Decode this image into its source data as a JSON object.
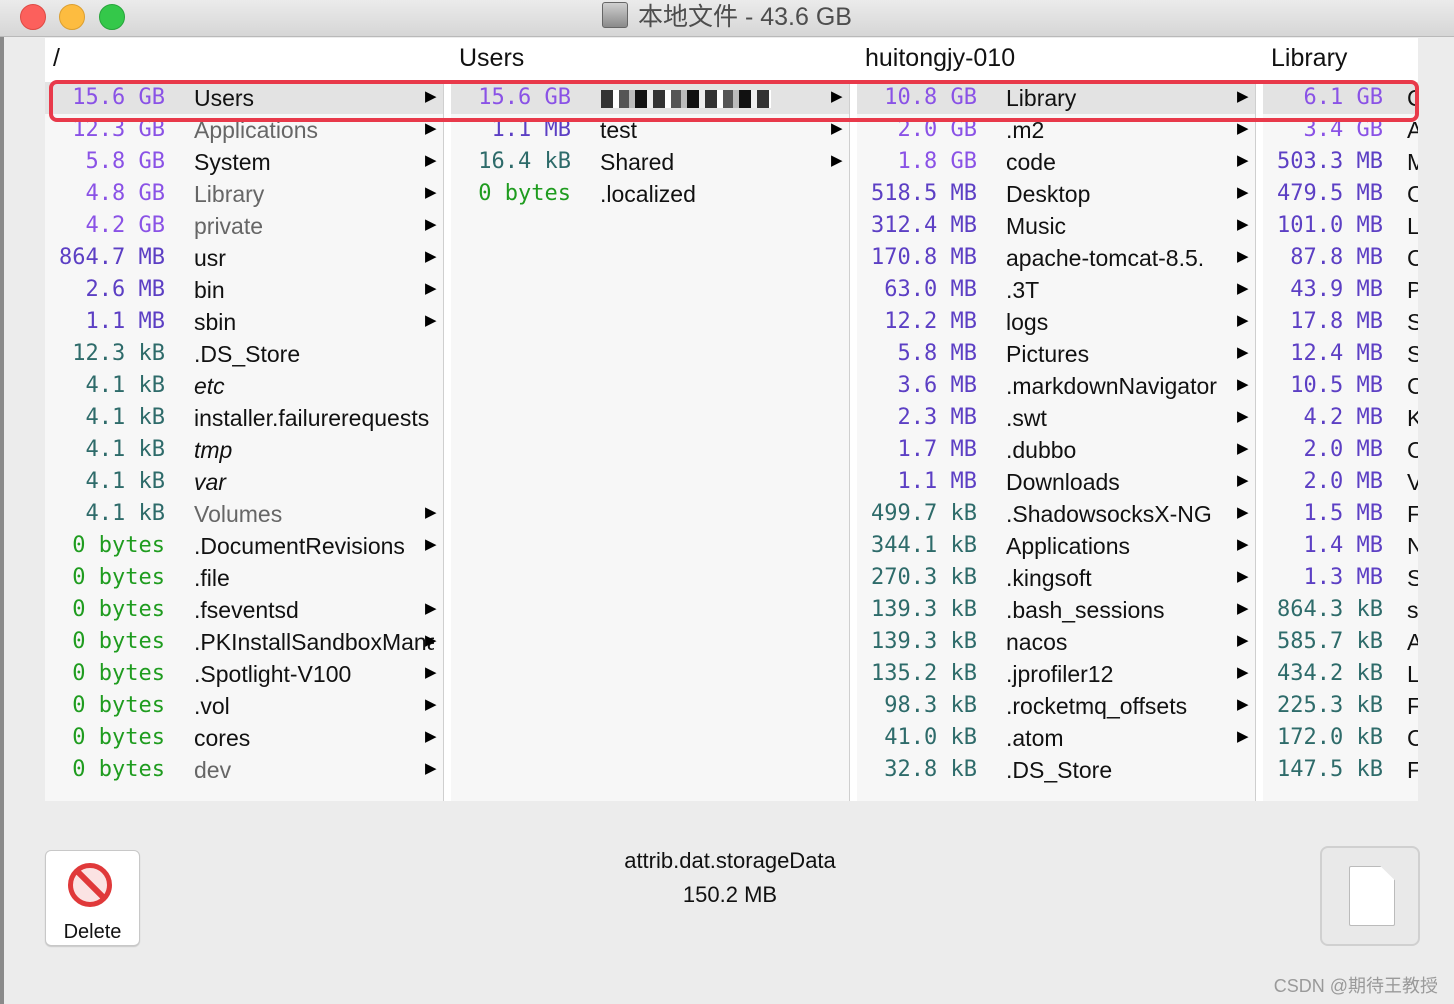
{
  "window": {
    "title": "本地文件 - 43.6 GB"
  },
  "columns": [
    {
      "header": "/",
      "rows": [
        {
          "size": "15.6 GB",
          "unit": "gb",
          "name": "Users",
          "arrow": true,
          "style": "",
          "selected": true
        },
        {
          "size": "12.3 GB",
          "unit": "gb",
          "name": "Applications",
          "arrow": true,
          "style": "dim"
        },
        {
          "size": "5.8 GB",
          "unit": "gb",
          "name": "System",
          "arrow": true,
          "style": ""
        },
        {
          "size": "4.8 GB",
          "unit": "gb",
          "name": "Library",
          "arrow": true,
          "style": "dim"
        },
        {
          "size": "4.2 GB",
          "unit": "gb",
          "name": "private",
          "arrow": true,
          "style": "dim"
        },
        {
          "size": "864.7 MB",
          "unit": "mb",
          "name": "usr",
          "arrow": true,
          "style": ""
        },
        {
          "size": "2.6 MB",
          "unit": "mb",
          "name": "bin",
          "arrow": true,
          "style": ""
        },
        {
          "size": "1.1 MB",
          "unit": "mb",
          "name": "sbin",
          "arrow": true,
          "style": ""
        },
        {
          "size": "12.3 kB",
          "unit": "kb",
          "name": ".DS_Store",
          "arrow": false,
          "style": ""
        },
        {
          "size": "4.1 kB",
          "unit": "kb",
          "name": "etc",
          "arrow": false,
          "style": "it"
        },
        {
          "size": "4.1 kB",
          "unit": "kb",
          "name": "installer.failurerequests",
          "arrow": false,
          "style": ""
        },
        {
          "size": "4.1 kB",
          "unit": "kb",
          "name": "tmp",
          "arrow": false,
          "style": "it"
        },
        {
          "size": "4.1 kB",
          "unit": "kb",
          "name": "var",
          "arrow": false,
          "style": "it"
        },
        {
          "size": "4.1 kB",
          "unit": "kb",
          "name": "Volumes",
          "arrow": true,
          "style": "dim"
        },
        {
          "size": "0 bytes",
          "unit": "b",
          "name": ".DocumentRevisions",
          "arrow": true,
          "style": ""
        },
        {
          "size": "0 bytes",
          "unit": "b",
          "name": ".file",
          "arrow": false,
          "style": ""
        },
        {
          "size": "0 bytes",
          "unit": "b",
          "name": ".fseventsd",
          "arrow": true,
          "style": ""
        },
        {
          "size": "0 bytes",
          "unit": "b",
          "name": ".PKInstallSandboxManager",
          "arrow": true,
          "style": ""
        },
        {
          "size": "0 bytes",
          "unit": "b",
          "name": ".Spotlight-V100",
          "arrow": true,
          "style": ""
        },
        {
          "size": "0 bytes",
          "unit": "b",
          "name": ".vol",
          "arrow": true,
          "style": ""
        },
        {
          "size": "0 bytes",
          "unit": "b",
          "name": "cores",
          "arrow": true,
          "style": ""
        },
        {
          "size": "0 bytes",
          "unit": "b",
          "name": "dev",
          "arrow": true,
          "style": "dim"
        }
      ]
    },
    {
      "header": "Users",
      "rows": [
        {
          "size": "15.6 GB",
          "unit": "gb",
          "name": "",
          "redacted": true,
          "arrow": true,
          "style": "",
          "selected": true
        },
        {
          "size": "1.1 MB",
          "unit": "mb",
          "name": "test",
          "arrow": true,
          "style": ""
        },
        {
          "size": "16.4 kB",
          "unit": "kb",
          "name": "Shared",
          "arrow": true,
          "style": ""
        },
        {
          "size": "0 bytes",
          "unit": "b",
          "name": ".localized",
          "arrow": false,
          "style": ""
        }
      ]
    },
    {
      "header": "huitongjy-010",
      "rows": [
        {
          "size": "10.8 GB",
          "unit": "gb",
          "name": "Library",
          "arrow": true,
          "style": "",
          "selected": true
        },
        {
          "size": "2.0 GB",
          "unit": "gb",
          "name": ".m2",
          "arrow": true,
          "style": ""
        },
        {
          "size": "1.8 GB",
          "unit": "gb",
          "name": "code",
          "arrow": true,
          "style": ""
        },
        {
          "size": "518.5 MB",
          "unit": "mb",
          "name": "Desktop",
          "arrow": true,
          "style": ""
        },
        {
          "size": "312.4 MB",
          "unit": "mb",
          "name": "Music",
          "arrow": true,
          "style": ""
        },
        {
          "size": "170.8 MB",
          "unit": "mb",
          "name": "apache-tomcat-8.5.",
          "arrow": true,
          "style": ""
        },
        {
          "size": "63.0 MB",
          "unit": "mb",
          "name": ".3T",
          "arrow": true,
          "style": ""
        },
        {
          "size": "12.2 MB",
          "unit": "mb",
          "name": "logs",
          "arrow": true,
          "style": ""
        },
        {
          "size": "5.8 MB",
          "unit": "mb",
          "name": "Pictures",
          "arrow": true,
          "style": ""
        },
        {
          "size": "3.6 MB",
          "unit": "mb",
          "name": ".markdownNavigator",
          "arrow": true,
          "style": ""
        },
        {
          "size": "2.3 MB",
          "unit": "mb",
          "name": ".swt",
          "arrow": true,
          "style": ""
        },
        {
          "size": "1.7 MB",
          "unit": "mb",
          "name": ".dubbo",
          "arrow": true,
          "style": ""
        },
        {
          "size": "1.1 MB",
          "unit": "mb",
          "name": "Downloads",
          "arrow": true,
          "style": ""
        },
        {
          "size": "499.7 kB",
          "unit": "kb",
          "name": ".ShadowsocksX-NG",
          "arrow": true,
          "style": ""
        },
        {
          "size": "344.1 kB",
          "unit": "kb",
          "name": "Applications",
          "arrow": true,
          "style": ""
        },
        {
          "size": "270.3 kB",
          "unit": "kb",
          "name": ".kingsoft",
          "arrow": true,
          "style": ""
        },
        {
          "size": "139.3 kB",
          "unit": "kb",
          "name": ".bash_sessions",
          "arrow": true,
          "style": ""
        },
        {
          "size": "139.3 kB",
          "unit": "kb",
          "name": "nacos",
          "arrow": true,
          "style": ""
        },
        {
          "size": "135.2 kB",
          "unit": "kb",
          "name": ".jprofiler12",
          "arrow": true,
          "style": ""
        },
        {
          "size": "98.3 kB",
          "unit": "kb",
          "name": ".rocketmq_offsets",
          "arrow": true,
          "style": ""
        },
        {
          "size": "41.0 kB",
          "unit": "kb",
          "name": ".atom",
          "arrow": true,
          "style": ""
        },
        {
          "size": "32.8 kB",
          "unit": "kb",
          "name": ".DS_Store",
          "arrow": false,
          "style": ""
        }
      ]
    },
    {
      "header": "Library",
      "rows": [
        {
          "size": "6.1 GB",
          "unit": "gb",
          "name": "C",
          "arrow": false,
          "style": "",
          "selected": true
        },
        {
          "size": "3.4 GB",
          "unit": "gb",
          "name": "A",
          "arrow": false,
          "style": ""
        },
        {
          "size": "503.3 MB",
          "unit": "mb",
          "name": "M",
          "arrow": false,
          "style": ""
        },
        {
          "size": "479.5 MB",
          "unit": "mb",
          "name": "C",
          "arrow": false,
          "style": ""
        },
        {
          "size": "101.0 MB",
          "unit": "mb",
          "name": "L",
          "arrow": false,
          "style": ""
        },
        {
          "size": "87.8 MB",
          "unit": "mb",
          "name": "C",
          "arrow": false,
          "style": ""
        },
        {
          "size": "43.9 MB",
          "unit": "mb",
          "name": "P",
          "arrow": false,
          "style": ""
        },
        {
          "size": "17.8 MB",
          "unit": "mb",
          "name": "S",
          "arrow": false,
          "style": ""
        },
        {
          "size": "12.4 MB",
          "unit": "mb",
          "name": "S",
          "arrow": false,
          "style": ""
        },
        {
          "size": "10.5 MB",
          "unit": "mb",
          "name": "C",
          "arrow": false,
          "style": ""
        },
        {
          "size": "4.2 MB",
          "unit": "mb",
          "name": "K",
          "arrow": false,
          "style": ""
        },
        {
          "size": "2.0 MB",
          "unit": "mb",
          "name": "C",
          "arrow": false,
          "style": ""
        },
        {
          "size": "2.0 MB",
          "unit": "mb",
          "name": "V",
          "arrow": false,
          "style": ""
        },
        {
          "size": "1.5 MB",
          "unit": "mb",
          "name": "F",
          "arrow": false,
          "style": ""
        },
        {
          "size": "1.4 MB",
          "unit": "mb",
          "name": "N",
          "arrow": false,
          "style": ""
        },
        {
          "size": "1.3 MB",
          "unit": "mb",
          "name": "S",
          "arrow": false,
          "style": ""
        },
        {
          "size": "864.3 kB",
          "unit": "kb",
          "name": "s",
          "arrow": false,
          "style": ""
        },
        {
          "size": "585.7 kB",
          "unit": "kb",
          "name": "A",
          "arrow": false,
          "style": ""
        },
        {
          "size": "434.2 kB",
          "unit": "kb",
          "name": "L",
          "arrow": false,
          "style": ""
        },
        {
          "size": "225.3 kB",
          "unit": "kb",
          "name": "F",
          "arrow": false,
          "style": ""
        },
        {
          "size": "172.0 kB",
          "unit": "kb",
          "name": "C",
          "arrow": false,
          "style": ""
        },
        {
          "size": "147.5 kB",
          "unit": "kb",
          "name": "F",
          "arrow": false,
          "style": ""
        }
      ]
    }
  ],
  "footer": {
    "delete_label": "Delete",
    "selected_file": "attrib.dat.storageData",
    "selected_size": "150.2 MB"
  },
  "watermark": "CSDN @期待王教授",
  "colors": {
    "gb": "#8a52e6",
    "mb": "#5c3fc4",
    "kb": "#2e6b6a",
    "bytes": "#1f9c1f",
    "highlight": "#e8394a"
  },
  "icons": {
    "delete": "no-entry-icon",
    "preview": "document-icon",
    "drive": "hard-drive-icon",
    "arrow": "disclosure-arrow-icon"
  }
}
